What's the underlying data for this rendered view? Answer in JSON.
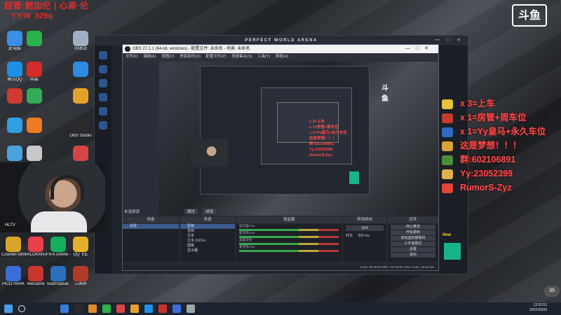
{
  "overlay": {
    "watermark_line1": "超管:鲍加伦 | 心扉·伦",
    "watermark_line2": "YY:W_829q",
    "logo_text": "斗鱼",
    "lines": [
      "x 3=上车",
      "x 1=房管+周车位",
      "x 1=Yy皇马+永久车位",
      "这是梦想！！！",
      "群:602106891",
      "Yy:23052399",
      "RumorS-Zyz"
    ],
    "line_icon_colors": [
      "#e8c23a",
      "#c43b2f",
      "#2f6bc4",
      "#d9a13a",
      "#4b8f3a",
      "#e0b04a",
      "#e2443a"
    ],
    "webcam_tag": "HLTV"
  },
  "desktop": {
    "icons": [
      {
        "label": "此电脑",
        "color": "#3a8ee6"
      },
      {
        "label": "",
        "color": "#2bb24c"
      },
      {
        "label": "回收站",
        "color": "#9fb0c2"
      },
      {
        "label": "腾讯QQ",
        "color": "#1d90e6"
      },
      {
        "label": "网易",
        "color": "#d62b2b"
      },
      {
        "label": "",
        "color": "#2d8be0"
      },
      {
        "label": "",
        "color": "#cf3b2f"
      },
      {
        "label": "",
        "color": "#33aa55"
      },
      {
        "label": "",
        "color": "#e5a22b"
      },
      {
        "label": "",
        "color": "#2fa0e0"
      },
      {
        "label": "",
        "color": "#ee7b22"
      },
      {
        "label": "OBS Studio",
        "color": "#2b2b2b"
      },
      {
        "label": "",
        "color": "#4aa3df"
      },
      {
        "label": "",
        "color": "#c8c8c8"
      },
      {
        "label": "",
        "color": "#d64545"
      }
    ],
    "bottom_icons": [
      {
        "label": "Counter-Strike: Global Off...",
        "color": "#d8a62a"
      },
      {
        "label": "VALORANT",
        "color": "#e8404a"
      },
      {
        "label": "FIFA Online 4",
        "color": "#14ae5c"
      },
      {
        "label": "QQ飞车",
        "color": "#e6b12a"
      },
      {
        "label": "PICO PARK",
        "color": "#3a6ed6"
      },
      {
        "label": "WeGame",
        "color": "#c8352f"
      },
      {
        "label": "TeamSpeak 3",
        "color": "#2b6fbf"
      },
      {
        "label": "三国杀",
        "color": "#b33a2a"
      }
    ]
  },
  "app": {
    "title": "PERFECT WORLD ARENA",
    "obs_title": "OBS 27.1.1 (64-bit, windows) - 配置文件: 未命名 - 场景: 未命名",
    "obs_menu": "文件(F) 编辑(E) 视图(V) 停靠部件(D) 配置文件(P) 场景集合(S) 工具(T) 帮助(H)",
    "scene_label": "未选择源",
    "properties_btn": "属性",
    "filters_btn": "滤镜",
    "docks": {
      "scenes": "场景",
      "sources": "来源",
      "mixer": "混音器",
      "transitions": "转场特效",
      "controls": "控件"
    },
    "scene_item": "场景",
    "sources": [
      "图像",
      "音频",
      "文本",
      "文本 (GDI+)",
      "图像",
      "显示器"
    ],
    "mixer_channels": [
      "显示器/Aux",
      "麦克风/Aux",
      "桌面音频",
      "麦克风/Aux"
    ],
    "transition_name": "淡出",
    "duration_label": "时长",
    "duration_value": "300 ms",
    "controls": [
      "停止推流",
      "开始录制",
      "启动虚拟摄像机",
      "工作室模式",
      "设置",
      "退出"
    ],
    "status": "LIVE: 00:00:00   REC: 00:00:00   CPU: 0.4%, 30.00 fps",
    "ad_badge": "New"
  },
  "taskbar": {
    "time": "13:32:53",
    "date": "2022/03/06",
    "counter": "35"
  }
}
